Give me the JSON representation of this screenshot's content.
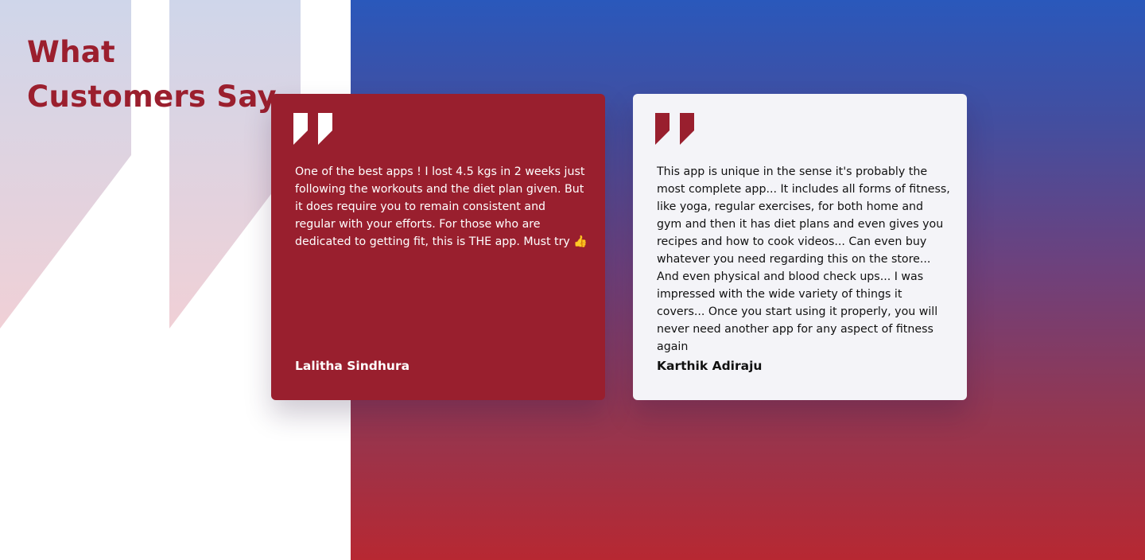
{
  "section": {
    "title_line1": "What",
    "title_line2": "Customers Say"
  },
  "colors": {
    "brand_red": "#991f2e",
    "gradient_top": "#2a58bb",
    "gradient_bottom": "#b72832",
    "card_light": "#f4f4f8"
  },
  "icons": {
    "background": "quote-mark-icon",
    "card": "quote-mark-icon"
  },
  "testimonials": [
    {
      "text": "One of the best apps ! I lost 4.5 kgs in 2 weeks just following the workouts and the diet plan given. But it does require you to remain consistent and regular with your efforts. For those who are dedicated to getting fit, this is THE app. Must try 👍",
      "author": "Lalitha Sindhura"
    },
    {
      "text": "This app is unique in the sense it's probably the most complete app... It includes all forms of fitness, like yoga, regular exercises, for both home and gym and then it has diet plans and even gives you recipes and how to cook videos... Can even buy whatever you need regarding this on the store... And even physical and blood check ups... I was impressed with the wide variety of things it covers... Once you start using it properly, you will never need another app for any aspect of fitness again",
      "author": "Karthik Adiraju"
    }
  ]
}
